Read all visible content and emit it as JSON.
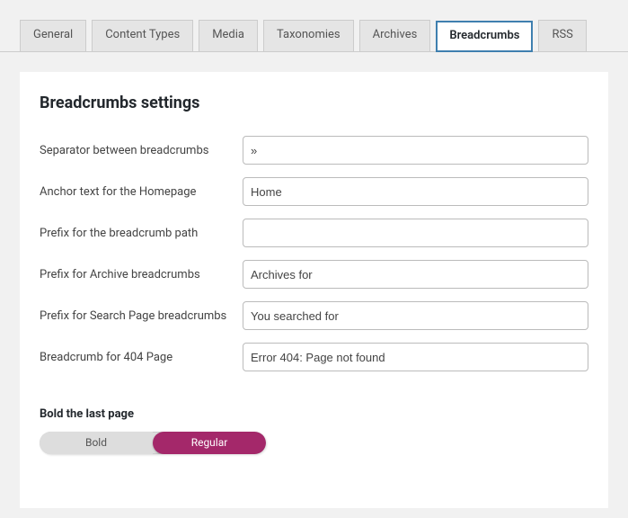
{
  "tabs": {
    "general": "General",
    "content_types": "Content Types",
    "media": "Media",
    "taxonomies": "Taxonomies",
    "archives": "Archives",
    "breadcrumbs": "Breadcrumbs",
    "rss": "RSS"
  },
  "section_title": "Breadcrumbs settings",
  "fields": {
    "separator": {
      "label": "Separator between breadcrumbs",
      "value": "»"
    },
    "anchor_home": {
      "label": "Anchor text for the Homepage",
      "value": "Home"
    },
    "prefix_path": {
      "label": "Prefix for the breadcrumb path",
      "value": ""
    },
    "prefix_archive": {
      "label": "Prefix for Archive breadcrumbs",
      "value": "Archives for"
    },
    "prefix_search": {
      "label": "Prefix for Search Page breadcrumbs",
      "value": "You searched for"
    },
    "bc_404": {
      "label": "Breadcrumb for 404 Page",
      "value": "Error 404: Page not found"
    }
  },
  "bold_last": {
    "heading": "Bold the last page",
    "bold": "Bold",
    "regular": "Regular"
  }
}
